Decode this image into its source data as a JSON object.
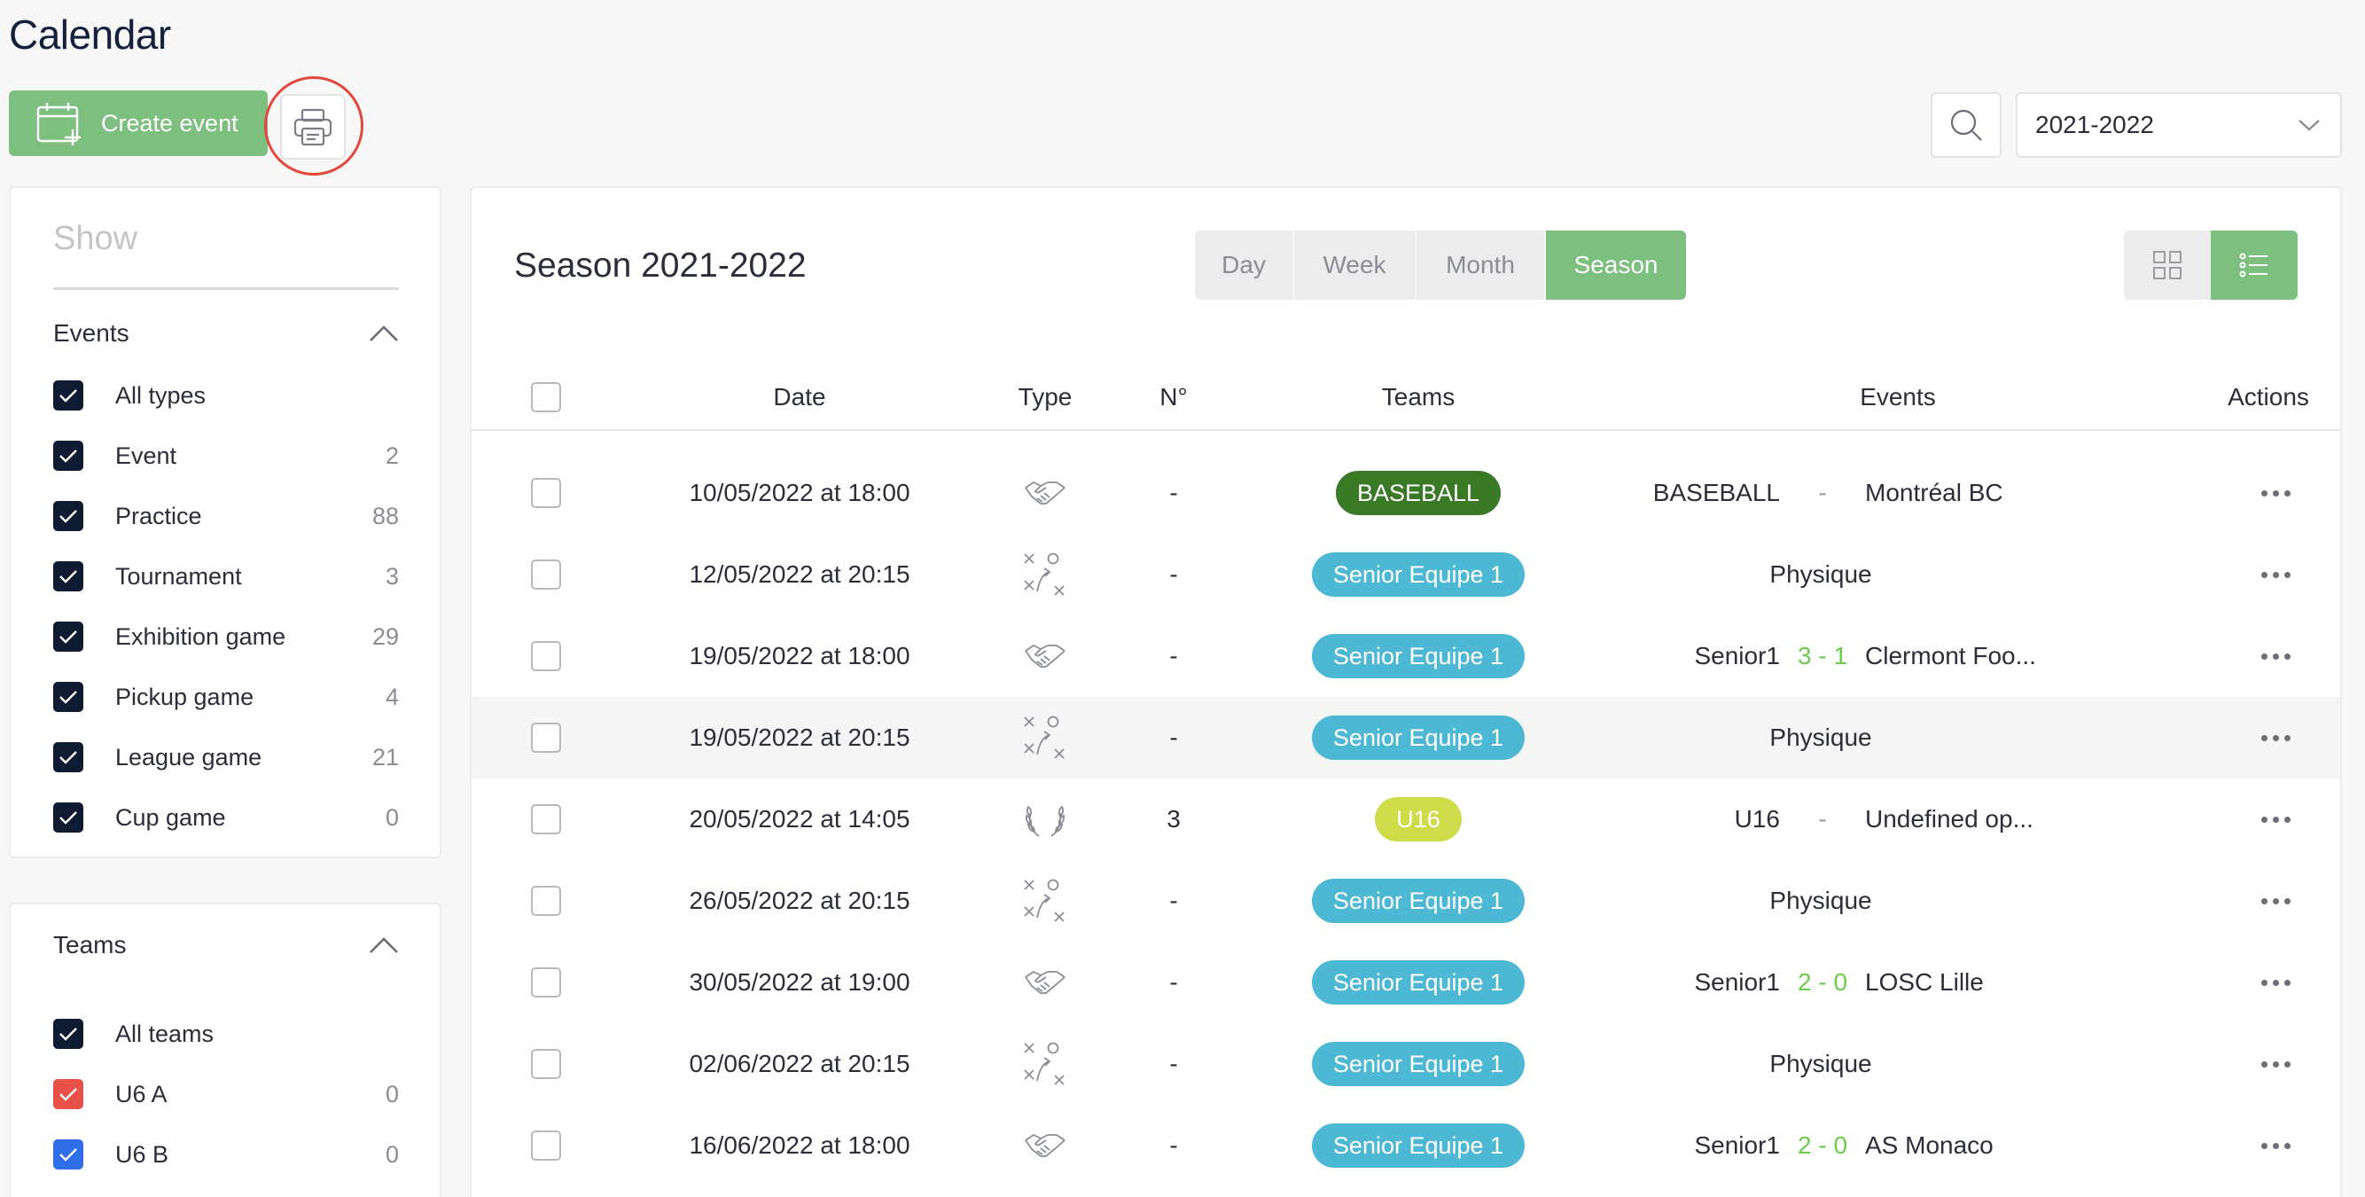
{
  "page": {
    "title": "Calendar"
  },
  "toolbar": {
    "create_label": "Create event",
    "season_value": "2021-2022"
  },
  "colors": {
    "green": "#7cbf7f",
    "navy": "#0f1a33",
    "baseball_badge": "#3a7a27",
    "senior_badge": "#4db8d4",
    "u16_badge": "#cfdc4a",
    "highlight_ring": "#e2483b",
    "u6a_check": "#e8504a",
    "u6b_check": "#2f6ee8"
  },
  "sidebar": {
    "show_placeholder": "Show",
    "events_heading": "Events",
    "event_filters": [
      {
        "label": "All types",
        "count": ""
      },
      {
        "label": "Event",
        "count": "2"
      },
      {
        "label": "Practice",
        "count": "88"
      },
      {
        "label": "Tournament",
        "count": "3"
      },
      {
        "label": "Exhibition game",
        "count": "29"
      },
      {
        "label": "Pickup game",
        "count": "4"
      },
      {
        "label": "League game",
        "count": "21"
      },
      {
        "label": "Cup game",
        "count": "0"
      }
    ],
    "teams_heading": "Teams",
    "team_filters": [
      {
        "label": "All teams",
        "count": ""
      },
      {
        "label": "U6 A",
        "count": "0"
      },
      {
        "label": "U6 B",
        "count": "0"
      }
    ]
  },
  "main": {
    "title": "Season 2021-2022",
    "tabs": [
      "Day",
      "Week",
      "Month",
      "Season"
    ],
    "active_tab": "Season",
    "columns": {
      "date": "Date",
      "type": "Type",
      "number": "N°",
      "teams": "Teams",
      "events": "Events",
      "actions": "Actions"
    },
    "rows": [
      {
        "date": "10/05/2022 at 18:00",
        "type_icon": "handshake-icon",
        "number": "-",
        "team": "BASEBALL",
        "team_color": "baseball",
        "ev_left": "BASEBALL",
        "ev_mid": "-",
        "ev_right": "Montréal BC"
      },
      {
        "date": "12/05/2022 at 20:15",
        "type_icon": "tactics-icon",
        "number": "-",
        "team": "Senior Equipe 1",
        "team_color": "senior",
        "ev_center": "Physique"
      },
      {
        "date": "19/05/2022 at 18:00",
        "type_icon": "handshake-icon",
        "number": "-",
        "team": "Senior Equipe 1",
        "team_color": "senior",
        "ev_left": "Senior1",
        "ev_mid": "3 - 1",
        "ev_right": "Clermont Foo..."
      },
      {
        "date": "19/05/2022 at 20:15",
        "type_icon": "tactics-icon",
        "number": "-",
        "team": "Senior Equipe 1",
        "team_color": "senior",
        "ev_center": "Physique"
      },
      {
        "date": "20/05/2022 at 14:05",
        "type_icon": "laurel-icon",
        "number": "3",
        "team": "U16",
        "team_color": "u16",
        "ev_left": "U16",
        "ev_mid": "-",
        "ev_right": "Undefined op..."
      },
      {
        "date": "26/05/2022 at 20:15",
        "type_icon": "tactics-icon",
        "number": "-",
        "team": "Senior Equipe 1",
        "team_color": "senior",
        "ev_center": "Physique"
      },
      {
        "date": "30/05/2022 at 19:00",
        "type_icon": "handshake-icon",
        "number": "-",
        "team": "Senior Equipe 1",
        "team_color": "senior",
        "ev_left": "Senior1",
        "ev_mid": "2 - 0",
        "ev_right": "LOSC Lille"
      },
      {
        "date": "02/06/2022 at 20:15",
        "type_icon": "tactics-icon",
        "number": "-",
        "team": "Senior Equipe 1",
        "team_color": "senior",
        "ev_center": "Physique"
      },
      {
        "date": "16/06/2022 at 18:00",
        "type_icon": "handshake-icon",
        "number": "-",
        "team": "Senior Equipe 1",
        "team_color": "senior",
        "ev_left": "Senior1",
        "ev_mid": "2 - 0",
        "ev_right": "AS Monaco"
      }
    ]
  }
}
